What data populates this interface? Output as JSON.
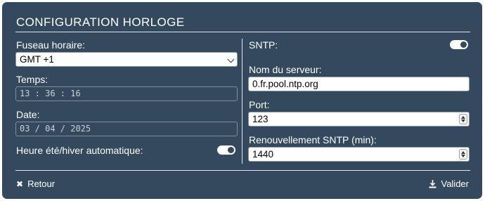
{
  "header": {
    "title": "CONFIGURATION HORLOGE"
  },
  "left": {
    "timezone_label": "Fuseau horaire:",
    "timezone_value": "GMT +1",
    "time_label": "Temps:",
    "time_value": "13 : 36 : 16",
    "date_label": "Date:",
    "date_value": "03 / 04 / 2025",
    "dst_label": "Heure été/hiver automatique:",
    "dst_enabled": true
  },
  "right": {
    "sntp_label": "SNTP:",
    "sntp_enabled": true,
    "server_label": "Nom du serveur:",
    "server_value": "0.fr.pool.ntp.org",
    "port_label": "Port:",
    "port_value": "123",
    "refresh_label": "Renouvellement SNTP (min):",
    "refresh_value": "1440"
  },
  "footer": {
    "back_label": "Retour",
    "back_icon": "close-icon",
    "save_label": "Valider",
    "save_icon": "download-icon"
  },
  "colors": {
    "panel_bg": "#34495e",
    "text": "#ffffff",
    "input_bg": "#ffffff"
  }
}
